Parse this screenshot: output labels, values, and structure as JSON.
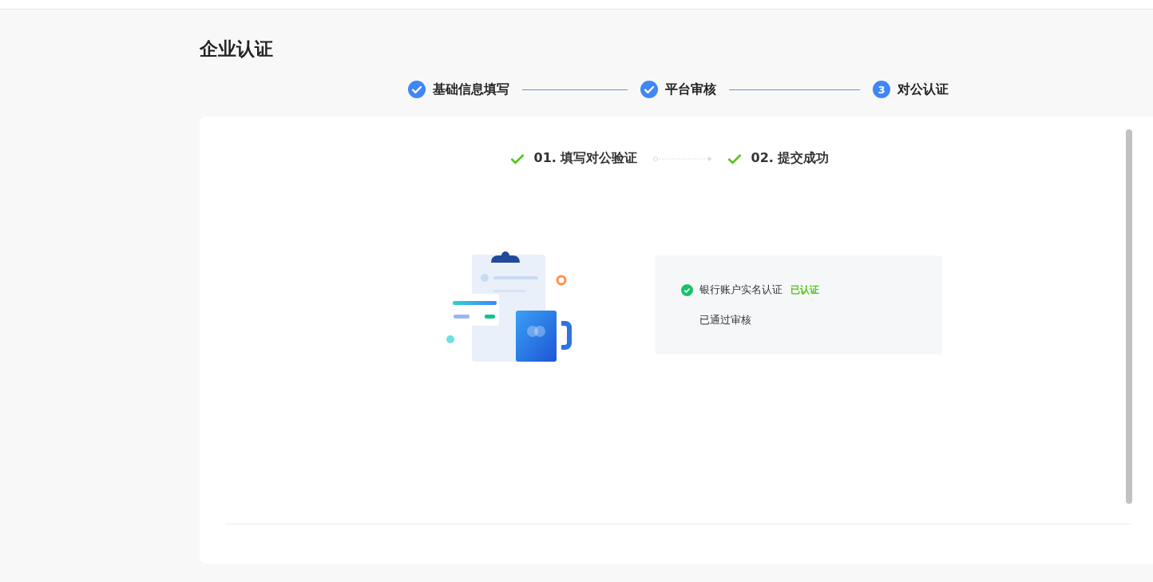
{
  "page_title": "企业认证",
  "steps": [
    {
      "label": "基础信息填写",
      "completed": true
    },
    {
      "label": "平台审核",
      "completed": true
    },
    {
      "label": "对公认证",
      "completed": false,
      "number": "3"
    }
  ],
  "sub_steps": [
    {
      "label": "01. 填写对公验证",
      "done": true
    },
    {
      "label": "02. 提交成功",
      "done": true
    }
  ],
  "result": {
    "title": "银行账户实名认证",
    "badge": "已认证",
    "verified": true,
    "message": "已通过审核"
  }
}
